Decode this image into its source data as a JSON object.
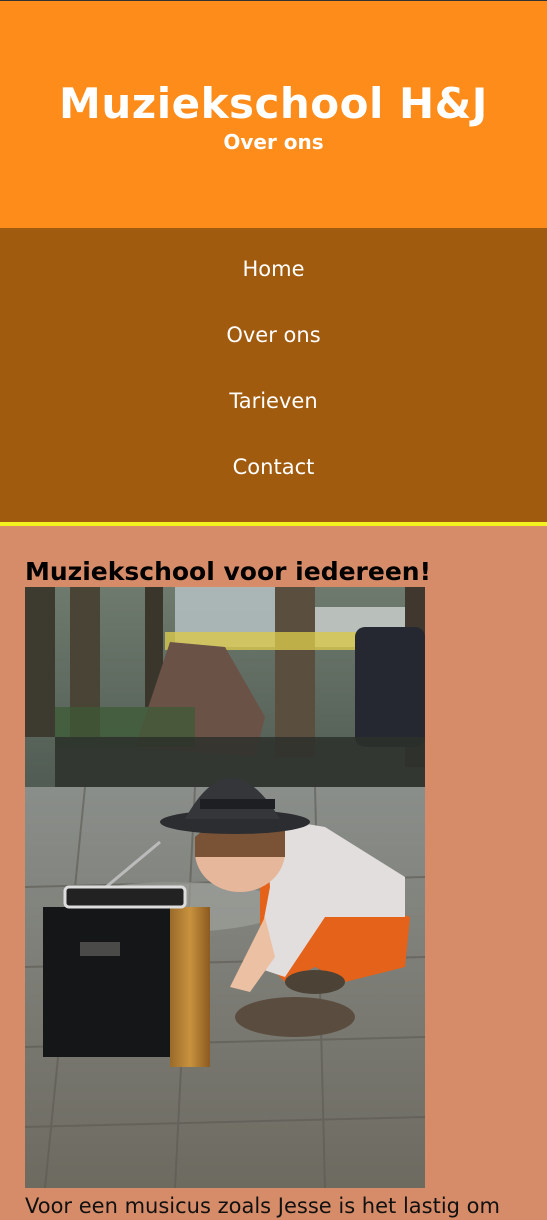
{
  "header": {
    "title": "Muziekschool H&J",
    "subtitle": "Over ons"
  },
  "nav": {
    "items": [
      {
        "label": "Home"
      },
      {
        "label": "Over ons"
      },
      {
        "label": "Tarieven"
      },
      {
        "label": "Contact"
      }
    ]
  },
  "main": {
    "heading": "Muziekschool voor iedereen!",
    "image_icon": "photo-child-with-radio",
    "paragraph": "Voor een musicus zoals Jesse is het lastig om"
  },
  "colors": {
    "header_bg": "#fe8c1b",
    "nav_bg": "#a15b0e",
    "nav_border": "#f4f21e",
    "page_bg": "#d78c69"
  }
}
